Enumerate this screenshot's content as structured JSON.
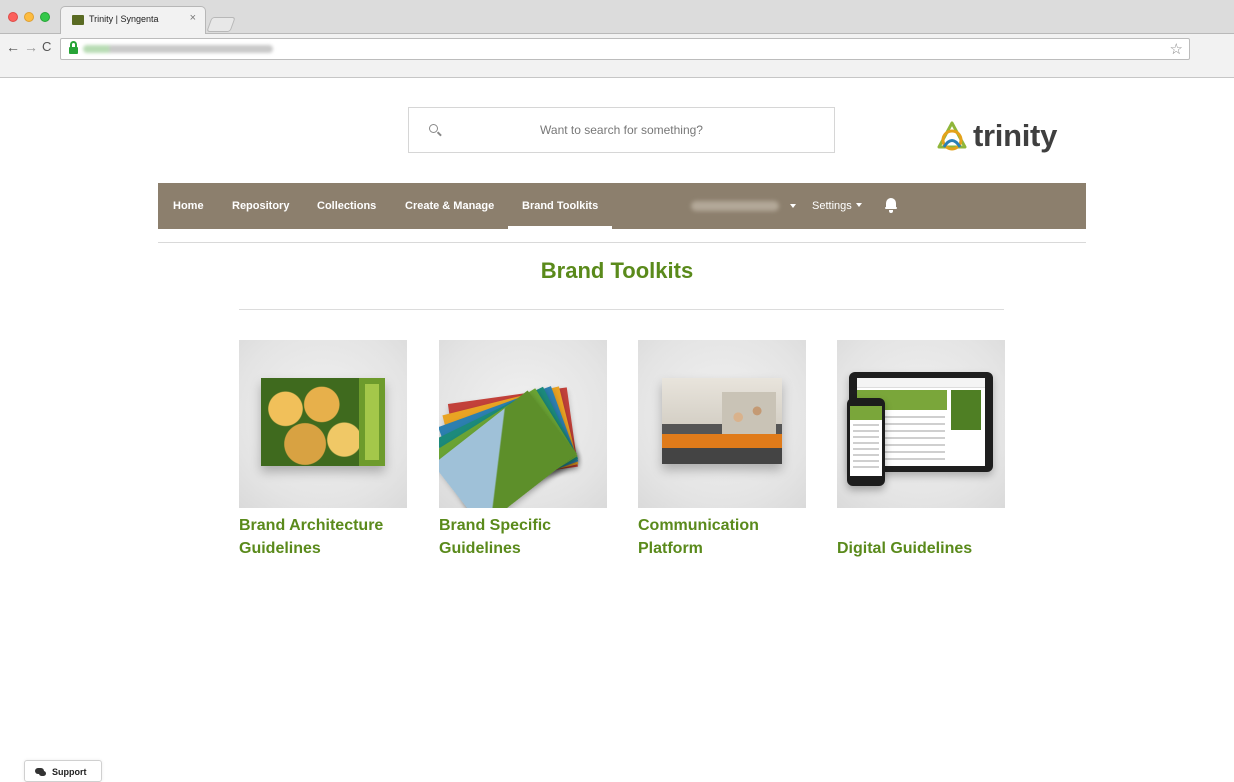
{
  "browser": {
    "tab_title": "Trinity | Syngenta",
    "tab_close": "×",
    "back": "←",
    "forward": "→",
    "reload": "C",
    "star": "☆"
  },
  "search": {
    "placeholder": "Want to search for something?"
  },
  "logo": {
    "text": "trinity"
  },
  "nav": {
    "items": [
      {
        "label": "Home"
      },
      {
        "label": "Repository"
      },
      {
        "label": "Collections"
      },
      {
        "label": "Create & Manage"
      },
      {
        "label": "Brand Toolkits",
        "active": true
      }
    ],
    "settings_label": "Settings"
  },
  "page": {
    "title": "Brand Toolkits"
  },
  "toolkits": [
    {
      "label": "Brand Architecture Guidelines"
    },
    {
      "label": "Brand Specific Guidelines"
    },
    {
      "label": "Communication Platform"
    },
    {
      "label": "Digital Guidelines"
    }
  ],
  "support": {
    "label": "Support"
  },
  "colors": {
    "brand_green": "#5a8a1b",
    "nav_background": "#8c7f6d"
  }
}
